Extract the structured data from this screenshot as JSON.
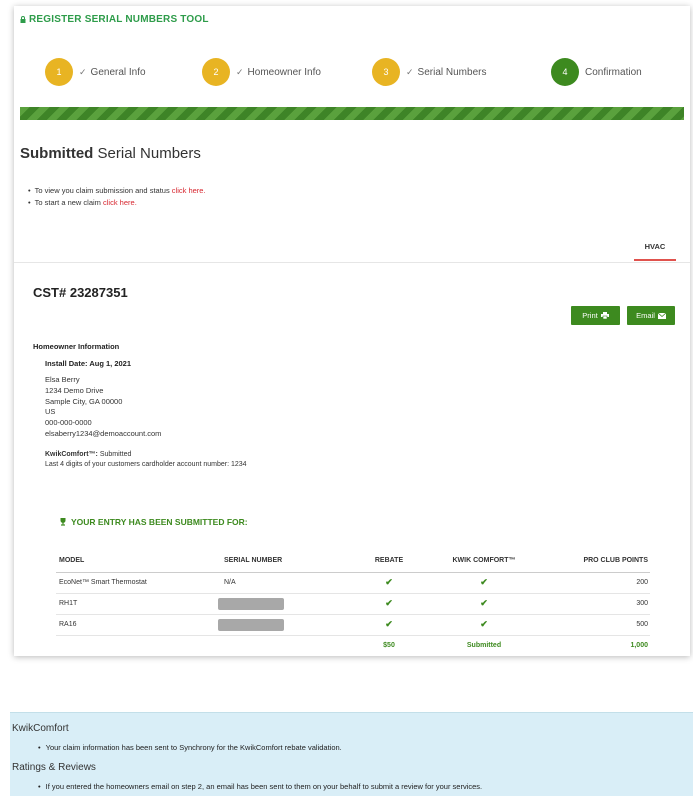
{
  "tool": {
    "title": "REGISTER SERIAL NUMBERS TOOL",
    "icon": "lock-icon"
  },
  "steps": [
    {
      "number": "1",
      "label": "General Info",
      "done": true
    },
    {
      "number": "2",
      "label": "Homeowner Info",
      "done": true
    },
    {
      "number": "3",
      "label": "Serial Numbers",
      "done": true
    },
    {
      "number": "4",
      "label": "Confirmation",
      "done": false
    }
  ],
  "progress": {
    "fraction": 1.0
  },
  "page": {
    "title_bold": "Submitted",
    "title_rest": "Serial Numbers"
  },
  "links": [
    {
      "text": "To view you claim submission and status",
      "link": "click here."
    },
    {
      "text": "To start a new claim",
      "link": "click here."
    }
  ],
  "tab": {
    "label": "HVAC"
  },
  "cst": {
    "label": "CST# 23287351"
  },
  "buttons": {
    "print": "Print",
    "email": "Email"
  },
  "homeowner": {
    "heading": "Homeowner Information",
    "install_date": "Install Date: Aug 1, 2021",
    "name": "Elsa Berry",
    "street": "1234 Demo Drive",
    "city": "Sample City, GA 00000",
    "country": "US",
    "phone": "000-000-0000",
    "email": "elsaberry1234@demoaccount.com",
    "kwik_label": "KwikComfort™:",
    "kwik_status": "Submitted",
    "cardholder": "Last 4 digits of your customers cardholder account number: 1234"
  },
  "submission": {
    "heading": "YOUR ENTRY HAS BEEN SUBMITTED FOR:",
    "columns": [
      "MODEL",
      "SERIAL NUMBER",
      "REBATE",
      "KWIK COMFORT™",
      "PRO CLUB POINTS"
    ],
    "rows": [
      {
        "model": "EcoNet™ Smart Thermostat",
        "serial": "N/A",
        "serial_redacted": false,
        "rebate": "✔",
        "kwik": "✔",
        "points": "200"
      },
      {
        "model": "RH1T",
        "serial": "",
        "serial_redacted": true,
        "rebate": "✔",
        "kwik": "✔",
        "points": "300"
      },
      {
        "model": "RA16",
        "serial": "",
        "serial_redacted": true,
        "rebate": "✔",
        "kwik": "✔",
        "points": "500"
      }
    ],
    "totals": {
      "rebate": "$50",
      "kwik": "Submitted",
      "points": "1,000"
    }
  },
  "info": {
    "kwik_heading": "KwikComfort",
    "kwik_item": "Your claim information has been sent to Synchrony for the KwikComfort rebate validation.",
    "reviews_heading": "Ratings & Reviews",
    "reviews_item": "If you entered the homeowners email on step 2, an email has been sent to them on your behalf to submit a review for your services."
  },
  "colors": {
    "green": "#3d8a1f",
    "step_yellow": "#e8b423",
    "link_red": "#d7262f",
    "info_bg": "#d9eef7"
  }
}
